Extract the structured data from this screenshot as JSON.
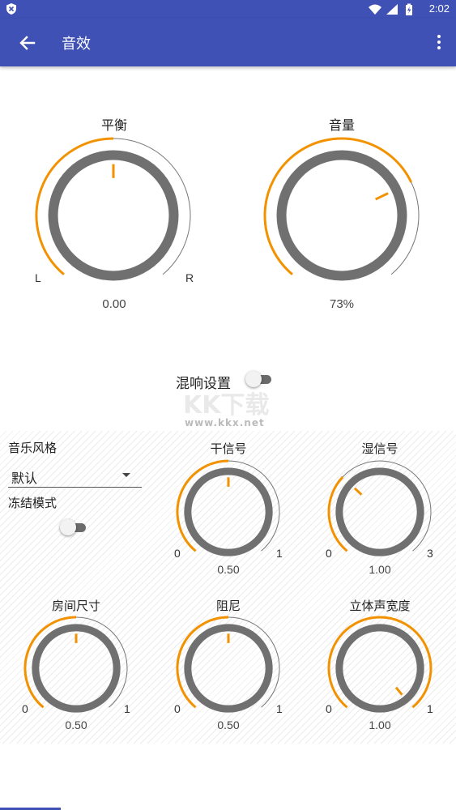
{
  "status_bar": {
    "time": "2:02",
    "icons": [
      "shield-icon",
      "wifi-icon",
      "signal-icon",
      "battery-icon"
    ]
  },
  "app_bar": {
    "title": "音效"
  },
  "colors": {
    "accent": "#3f51b5",
    "orange": "#f39200",
    "knob_gray": "#707070",
    "track_gray": "#777777"
  },
  "balance": {
    "label": "平衡",
    "value": "0.00",
    "left_label": "L",
    "right_label": "R",
    "level": 0.5
  },
  "volume": {
    "label": "音量",
    "value": "73%",
    "level": 0.73
  },
  "reverb": {
    "toggle_label": "混响设置",
    "enabled": false,
    "music_style": {
      "label": "音乐风格",
      "selected": "默认"
    },
    "freeze_mode": {
      "label": "冻结模式",
      "enabled": false
    },
    "dry": {
      "label": "干信号",
      "value": "0.50",
      "min": "0",
      "max": "1",
      "level": 0.5
    },
    "wet": {
      "label": "湿信号",
      "value": "1.00",
      "min": "0",
      "max": "3",
      "level": 0.333
    },
    "room_size": {
      "label": "房间尺寸",
      "value": "0.50",
      "min": "0",
      "max": "1",
      "level": 0.5
    },
    "damping": {
      "label": "阻尼",
      "value": "0.50",
      "min": "0",
      "max": "1",
      "level": 0.5
    },
    "width": {
      "label": "立体声宽度",
      "value": "1.00",
      "min": "0",
      "max": "1",
      "level": 1.0
    }
  }
}
